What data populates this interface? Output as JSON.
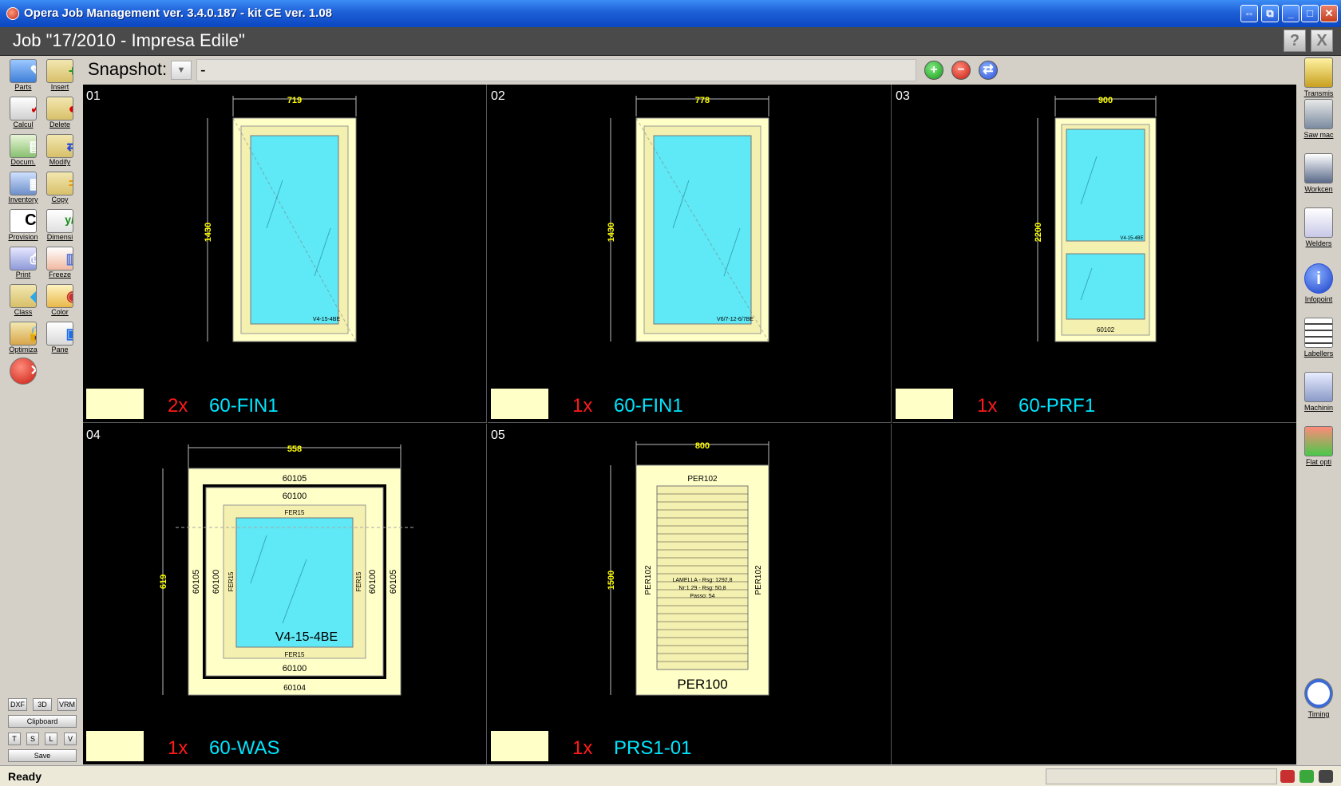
{
  "window": {
    "title": "Opera Job Management ver. 3.4.0.187 - kit CE ver. 1.08"
  },
  "job": {
    "title": "Job \"17/2010 - Impresa Edile\"",
    "help_label": "?",
    "close_label": "X"
  },
  "snapshot": {
    "label": "Snapshot:",
    "value": "-"
  },
  "left_toolbar": [
    {
      "label": "Parts",
      "icon": "parts-icon"
    },
    {
      "label": "Insert",
      "icon": "insert-icon"
    },
    {
      "label": "Calcul",
      "icon": "calcul-icon"
    },
    {
      "label": "Delete",
      "icon": "delete-icon"
    },
    {
      "label": "Docum.",
      "icon": "docum-icon"
    },
    {
      "label": "Modify",
      "icon": "modify-icon"
    },
    {
      "label": "Inventory",
      "icon": "inventory-icon"
    },
    {
      "label": "Copy",
      "icon": "copy-icon"
    },
    {
      "label": "Provision",
      "icon": "ce-icon"
    },
    {
      "label": "Dimensi",
      "icon": "dimensi-icon"
    },
    {
      "label": "Print",
      "icon": "print-icon"
    },
    {
      "label": "Freeze",
      "icon": "freeze-icon"
    },
    {
      "label": "Class",
      "icon": "class-icon"
    },
    {
      "label": "Color",
      "icon": "color-icon"
    },
    {
      "label": "Optimiza",
      "icon": "optimiza-icon"
    },
    {
      "label": "Pane",
      "icon": "pane-icon"
    }
  ],
  "bottom_tools": {
    "dxf": "DXF",
    "three_d": "3D",
    "vrm": "VRM",
    "clipboard": "Clipboard",
    "t": "T",
    "s": "S",
    "l": "L",
    "v": "V",
    "save": "Save"
  },
  "right_toolbar": [
    {
      "label": "Transmis",
      "icon": "transmis-icon"
    },
    {
      "label": "Saw mac",
      "icon": "saw-icon"
    },
    {
      "label": "Workcen",
      "icon": "workcen-icon"
    },
    {
      "label": "Welders",
      "icon": "welders-icon"
    },
    {
      "label": "Infopoint",
      "icon": "info-icon"
    },
    {
      "label": "Labellers",
      "icon": "label-icon"
    },
    {
      "label": "Machinin",
      "icon": "machinin-icon"
    },
    {
      "label": "Flat opti",
      "icon": "flatopti-icon"
    },
    {
      "label": "Timing",
      "icon": "clock-icon"
    }
  ],
  "positions": [
    {
      "number": "01",
      "qty": "2x",
      "code": "60-FIN1",
      "width": "719",
      "height": "1430",
      "glass": "V4-15-4BE"
    },
    {
      "number": "02",
      "qty": "1x",
      "code": "60-FIN1",
      "width": "778",
      "height": "1430",
      "glass": "V6/7-12-6/7BE"
    },
    {
      "number": "03",
      "qty": "1x",
      "code": "60-PRF1",
      "width": "900",
      "height": "2200",
      "glass": "V4-15-4BE",
      "mid_label": "60102"
    },
    {
      "number": "04",
      "qty": "1x",
      "code": "60-WAS",
      "width": "558",
      "height": "619",
      "glass": "V4-15-4BE",
      "labels": {
        "top_outer": "60105",
        "top_inner": "60100",
        "fer_top": "FER15",
        "fer_bottom": "FER15",
        "bottom_inner": "60100",
        "bottom_outer": "60104",
        "left_outer": "60105",
        "left_mid": "60100",
        "left_fer": "FER15",
        "right_fer": "FER15",
        "right_mid": "60100",
        "right_outer": "60105"
      }
    },
    {
      "number": "05",
      "qty": "1x",
      "code": "PRS1-01",
      "width": "800",
      "height": "1500",
      "labels": {
        "top": "PER102",
        "left": "PER102",
        "right": "PER102",
        "bottom": "PER100",
        "lamella1": "LAMELLA - Rsg: 1292,8",
        "lamella2": "Nr:1.29 - Rsg: 50,8",
        "lamella3": "Passo: 54"
      }
    }
  ],
  "status": {
    "text": "Ready"
  },
  "colors": {
    "frame": "#ffffc8",
    "glass": "#5fe8f5",
    "qty": "#ff1a1a",
    "code": "#00e5ff",
    "dimension": "#ffff00"
  }
}
